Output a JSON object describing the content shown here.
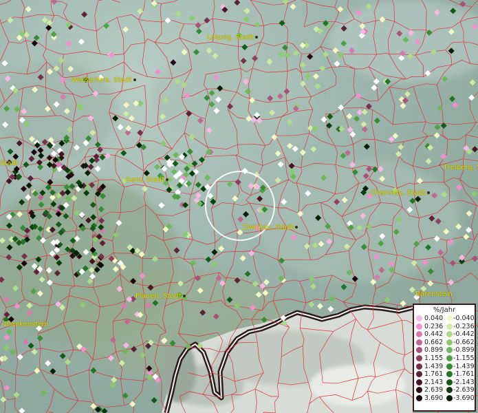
{
  "map": {
    "cities": [
      {
        "name": "Leipzig, Stadt",
        "id": "leipzig"
      },
      {
        "name": "Weißenfels, Stadt",
        "id": "weissenfels"
      },
      {
        "name": "Gera, Stadt",
        "id": "gera"
      },
      {
        "name": "Zwickau, Stadt",
        "id": "zwickau"
      },
      {
        "name": "Chemnitz, Stadt",
        "id": "chemnitz"
      },
      {
        "name": "Freiberg, Stadt",
        "id": "freiberg"
      },
      {
        "name": "Plauen, Stadt",
        "id": "plauen"
      },
      {
        "name": "Blankenstein",
        "id": "blankenstein"
      },
      {
        "name": "Bärenstein",
        "id": "baerenstein"
      },
      {
        "name": "Stadt",
        "id": "stadt-left"
      }
    ],
    "colors": {
      "border_lines": "#e0323a",
      "highlight_circle": "#ffffff",
      "label_text": "#e9e000"
    }
  },
  "legend": {
    "title": "%/Jahr",
    "positive": [
      {
        "value": "0.040",
        "color": "#f7b8e6"
      },
      {
        "value": "0.236",
        "color": "#f090cf"
      },
      {
        "value": "0.442",
        "color": "#d879b1"
      },
      {
        "value": "0.662",
        "color": "#c06894"
      },
      {
        "value": "0.899",
        "color": "#a8527a"
      },
      {
        "value": "1.155",
        "color": "#8f3f60"
      },
      {
        "value": "1.439",
        "color": "#76324c"
      },
      {
        "value": "1.761",
        "color": "#5d2238"
      },
      {
        "value": "2.143",
        "color": "#471726"
      },
      {
        "value": "2.639",
        "color": "#2e0c16"
      },
      {
        "value": "3.690",
        "color": "#160408"
      }
    ],
    "negative": [
      {
        "value": "-0.040",
        "color": "#f2f7c4"
      },
      {
        "value": "-0.236",
        "color": "#cfe9a6"
      },
      {
        "value": "-0.442",
        "color": "#aedb8a"
      },
      {
        "value": "-0.662",
        "color": "#8bcb6f"
      },
      {
        "value": "-0.899",
        "color": "#6db95b"
      },
      {
        "value": "-1.155",
        "color": "#4fa246"
      },
      {
        "value": "-1.439",
        "color": "#388c36"
      },
      {
        "value": "-1.761",
        "color": "#237427"
      },
      {
        "value": "-2.143",
        "color": "#135b18"
      },
      {
        "value": "-2.639",
        "color": "#083d0c"
      },
      {
        "value": "-3.690",
        "color": "#022004"
      }
    ]
  }
}
